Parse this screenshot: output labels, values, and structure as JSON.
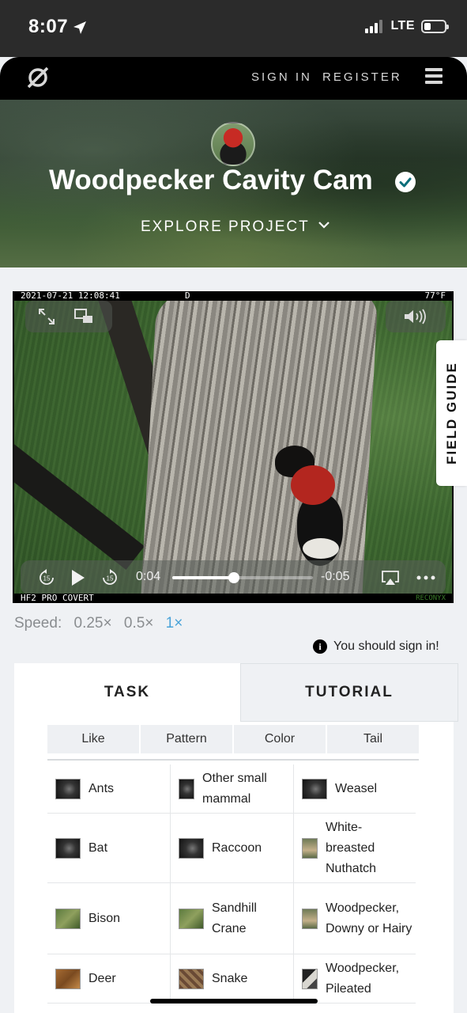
{
  "status_bar": {
    "time": "8:07",
    "network": "LTE"
  },
  "nav": {
    "sign_in": "SIGN IN",
    "register": "REGISTER"
  },
  "hero": {
    "title": "Woodpecker Cavity Cam",
    "explore": "EXPLORE PROJECT"
  },
  "video": {
    "overlay_date": "2021-07-21 12:08:41",
    "overlay_mode": "D",
    "overlay_temp": "77°F",
    "overlay_camera": "HF2 PRO COVERT",
    "overlay_brand": "RECONYX",
    "current_time": "0:04",
    "remaining_time": "-0:05",
    "progress": 0.44
  },
  "field_guide": "FIELD GUIDE",
  "speed": {
    "label": "Speed:",
    "options": [
      "0.25×",
      "0.5×",
      "1×"
    ],
    "active": "1×"
  },
  "notice": "You should sign in!",
  "panel": {
    "tabs": [
      "TASK",
      "TUTORIAL"
    ],
    "filters": [
      "Like",
      "Pattern",
      "Color",
      "Tail"
    ],
    "choices": [
      {
        "label": "Ants",
        "thumb": "t-dark"
      },
      {
        "label": "Other small mammal",
        "thumb": "t-dark"
      },
      {
        "label": "Weasel",
        "thumb": "t-dark"
      },
      {
        "label": "Bat",
        "thumb": "t-dark"
      },
      {
        "label": "Raccoon",
        "thumb": "t-dark"
      },
      {
        "label": "White-breasted Nuthatch",
        "thumb": "t-bird"
      },
      {
        "label": "Bison",
        "thumb": "t-green"
      },
      {
        "label": "Sandhill Crane",
        "thumb": "t-green"
      },
      {
        "label": "Woodpecker, Downy or Hairy",
        "thumb": "t-bird"
      },
      {
        "label": "Deer",
        "thumb": "t-brown"
      },
      {
        "label": "Snake",
        "thumb": "t-snake"
      },
      {
        "label": "Woodpecker, Pileated",
        "thumb": "t-bw"
      }
    ]
  },
  "colors": {
    "accent": "#4aa3d8",
    "nav_bg": "#000000",
    "page_bg": "#eff1f4"
  }
}
